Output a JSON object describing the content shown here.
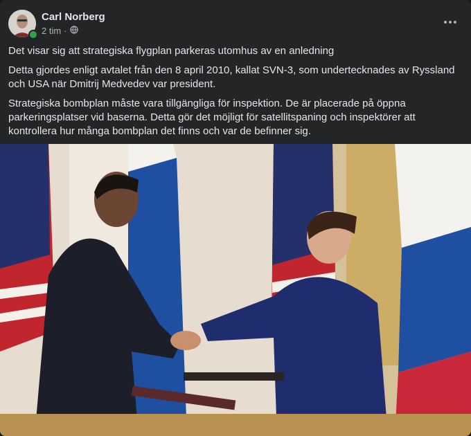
{
  "post": {
    "author": "Carl Norberg",
    "time": "2 tim",
    "separator": "·",
    "paragraphs": [
      "Det visar sig att strategiska flygplan parkeras utomhus av en anledning",
      "Detta gjordes enligt avtalet från den 8 april 2010, kallat SVN-3, som undertecknades av Ryssland och USA när Dmitrij Medvedev var president.",
      "Strategiska bombplan måste vara tillgängliga för inspektion. De är placerade på öppna parkeringsplatser vid baserna. Detta gör det möjligt för satellitspaning och inspektörer att kontrollera hur många bombplan det finns och var de befinner sig."
    ]
  },
  "icons": {
    "privacy": "globe-icon",
    "menu": "more-options-icon",
    "presence": "online-status-dot"
  },
  "colors": {
    "card_bg": "#242526",
    "text_primary": "#e4e6eb",
    "text_secondary": "#b0b3b8",
    "online": "#31a24c"
  }
}
